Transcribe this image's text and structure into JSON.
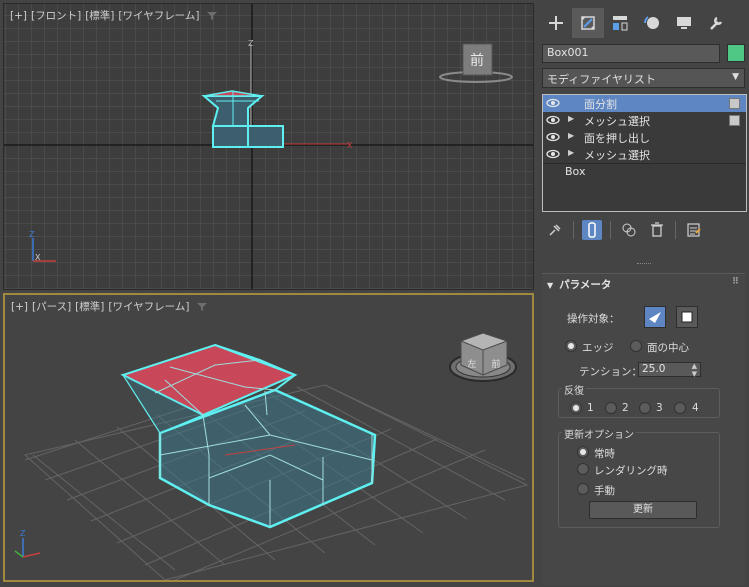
{
  "viewports": {
    "front": {
      "plus": "[+]",
      "view": "[フロント]",
      "shading": "[標準]",
      "mode": "[ワイヤフレーム]",
      "cube_label": "前"
    },
    "persp": {
      "plus": "[+]",
      "view": "[パース]",
      "shading": "[標準]",
      "mode": "[ワイヤフレーム]",
      "cube_labels": [
        "左",
        "前"
      ]
    }
  },
  "panel": {
    "tabs": [
      "create-icon",
      "modify-icon",
      "hierarchy-icon",
      "motion-icon",
      "display-icon",
      "utilities-icon"
    ],
    "active_tab": 1,
    "object_name": "Box001",
    "object_color": "#4fc886",
    "modifier_list": "モディファイヤリスト",
    "stack": [
      {
        "label": "面分割",
        "selected": true,
        "expand": false,
        "check": true
      },
      {
        "label": "メッシュ選択",
        "selected": false,
        "expand": true,
        "check": true
      },
      {
        "label": "面を押し出し",
        "selected": false,
        "expand": true,
        "check": false
      },
      {
        "label": "メッシュ選択",
        "selected": false,
        "expand": true,
        "check": false
      }
    ],
    "base_object": "Box",
    "rollout": {
      "title": "パラメータ",
      "operate_on": "操作対象：",
      "edge": "エッジ",
      "face_center": "面の中心",
      "tension_label": "テンション：",
      "tension_value": "25.0",
      "iterations_title": "反復",
      "iterations": [
        "1",
        "2",
        "3",
        "4"
      ],
      "iterations_selected": 0,
      "update_title": "更新オプション",
      "update_options": [
        "常時",
        "レンダリング時",
        "手動"
      ],
      "update_selected": 0,
      "update_button": "更新"
    }
  }
}
